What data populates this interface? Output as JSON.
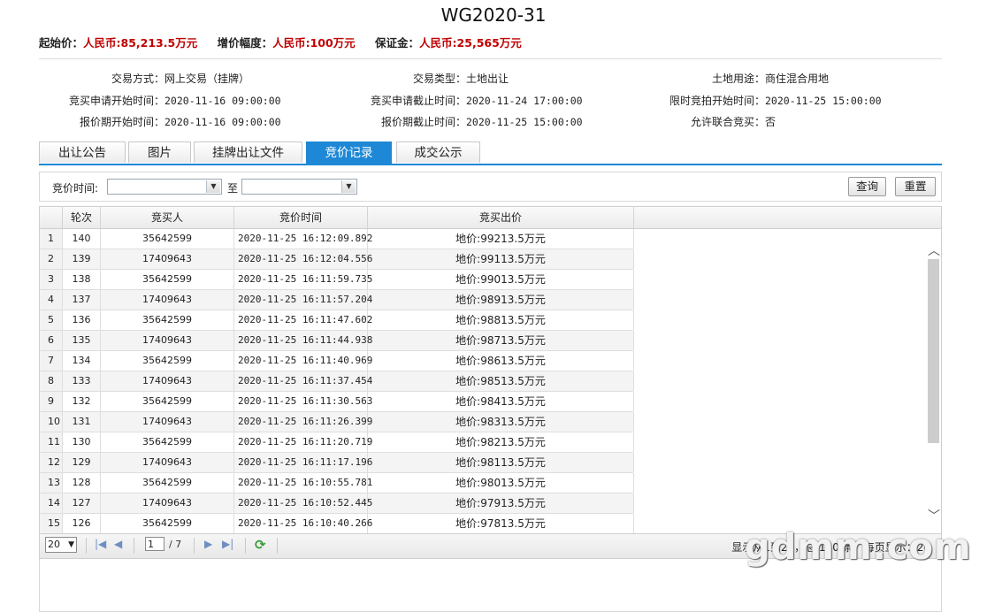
{
  "title": "WG2020-31",
  "price_bar": {
    "start_price_label": "起始价：",
    "start_price_value": "人民币:85,213.5万元",
    "increment_label": "增价幅度：",
    "increment_value": "人民币:100万元",
    "deposit_label": "保证金：",
    "deposit_value": "人民币:25,565万元"
  },
  "info": {
    "trade_mode_label": "交易方式：",
    "trade_mode_value": "网上交易（挂牌）",
    "trade_type_label": "交易类型：",
    "trade_type_value": "土地出让",
    "land_use_label": "土地用途：",
    "land_use_value": "商住混合用地",
    "apply_start_label": "竞买申请开始时间：",
    "apply_start_value": "2020-11-16 09:00:00",
    "apply_end_label": "竞买申请截止时间：",
    "apply_end_value": "2020-11-24 17:00:00",
    "limit_start_label": "限时竞拍开始时间：",
    "limit_start_value": "2020-11-25 15:00:00",
    "quote_start_label": "报价期开始时间：",
    "quote_start_value": "2020-11-16 09:00:00",
    "quote_end_label": "报价期截止时间：",
    "quote_end_value": "2020-11-25 15:00:00",
    "joint_label": "允许联合竞买：",
    "joint_value": "否"
  },
  "tabs": [
    "出让公告",
    "图片",
    "挂牌出让文件",
    "竞价记录",
    "成交公示"
  ],
  "active_tab": "竞价记录",
  "filter": {
    "time_label": "竞价时间:",
    "to_label": "至",
    "start_value": "",
    "end_value": "",
    "query_button": "查询",
    "reset_button": "重置"
  },
  "grid": {
    "columns": [
      "轮次",
      "竞买人",
      "竞价时间",
      "竞买出价"
    ],
    "rows": [
      {
        "idx": "1",
        "round": "140",
        "bidder": "35642599",
        "time": "2020-11-25 16:12:09.892",
        "price": "地价:99213.5万元"
      },
      {
        "idx": "2",
        "round": "139",
        "bidder": "17409643",
        "time": "2020-11-25 16:12:04.556",
        "price": "地价:99113.5万元"
      },
      {
        "idx": "3",
        "round": "138",
        "bidder": "35642599",
        "time": "2020-11-25 16:11:59.735",
        "price": "地价:99013.5万元"
      },
      {
        "idx": "4",
        "round": "137",
        "bidder": "17409643",
        "time": "2020-11-25 16:11:57.204",
        "price": "地价:98913.5万元"
      },
      {
        "idx": "5",
        "round": "136",
        "bidder": "35642599",
        "time": "2020-11-25 16:11:47.602",
        "price": "地价:98813.5万元"
      },
      {
        "idx": "6",
        "round": "135",
        "bidder": "17409643",
        "time": "2020-11-25 16:11:44.938",
        "price": "地价:98713.5万元"
      },
      {
        "idx": "7",
        "round": "134",
        "bidder": "35642599",
        "time": "2020-11-25 16:11:40.969",
        "price": "地价:98613.5万元"
      },
      {
        "idx": "8",
        "round": "133",
        "bidder": "17409643",
        "time": "2020-11-25 16:11:37.454",
        "price": "地价:98513.5万元"
      },
      {
        "idx": "9",
        "round": "132",
        "bidder": "35642599",
        "time": "2020-11-25 16:11:30.563",
        "price": "地价:98413.5万元"
      },
      {
        "idx": "10",
        "round": "131",
        "bidder": "17409643",
        "time": "2020-11-25 16:11:26.399",
        "price": "地价:98313.5万元"
      },
      {
        "idx": "11",
        "round": "130",
        "bidder": "35642599",
        "time": "2020-11-25 16:11:20.719",
        "price": "地价:98213.5万元"
      },
      {
        "idx": "12",
        "round": "129",
        "bidder": "17409643",
        "time": "2020-11-25 16:11:17.196",
        "price": "地价:98113.5万元"
      },
      {
        "idx": "13",
        "round": "128",
        "bidder": "35642599",
        "time": "2020-11-25 16:10:55.781",
        "price": "地价:98013.5万元"
      },
      {
        "idx": "14",
        "round": "127",
        "bidder": "17409643",
        "time": "2020-11-25 16:10:52.445",
        "price": "地价:97913.5万元"
      },
      {
        "idx": "15",
        "round": "126",
        "bidder": "35642599",
        "time": "2020-11-25 16:10:40.266",
        "price": "地价:97813.5万元"
      }
    ]
  },
  "pager": {
    "page_size": "20",
    "current_page": "1",
    "total_pages": "/ 7",
    "info_text": "显示从1到20，总 140 条，每页显示：20"
  },
  "watermark": "gdmm.com"
}
